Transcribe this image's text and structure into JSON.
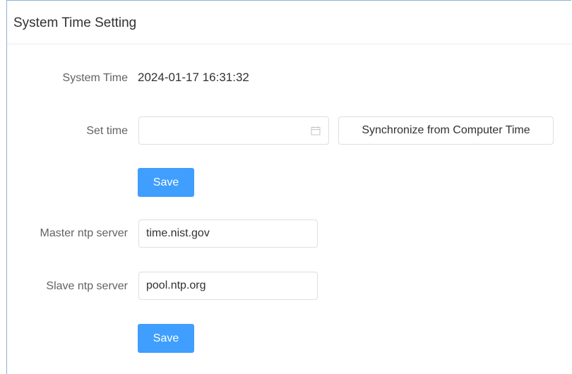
{
  "panel": {
    "title": "System Time Setting"
  },
  "system_time": {
    "label": "System Time",
    "value": "2024-01-17 16:31:32"
  },
  "set_time": {
    "label": "Set time",
    "value": "",
    "icon": "calendar-icon",
    "sync_button_label": "Synchronize from Computer Time"
  },
  "save_time": {
    "label": "Save"
  },
  "ntp": {
    "master_label": "Master ntp server",
    "master_value": "time.nist.gov",
    "slave_label": "Slave ntp server",
    "slave_value": "pool.ntp.org",
    "save_label": "Save"
  },
  "colors": {
    "primary": "#409eff",
    "border": "#dcdfe6",
    "text": "#303133",
    "label": "#606266"
  }
}
